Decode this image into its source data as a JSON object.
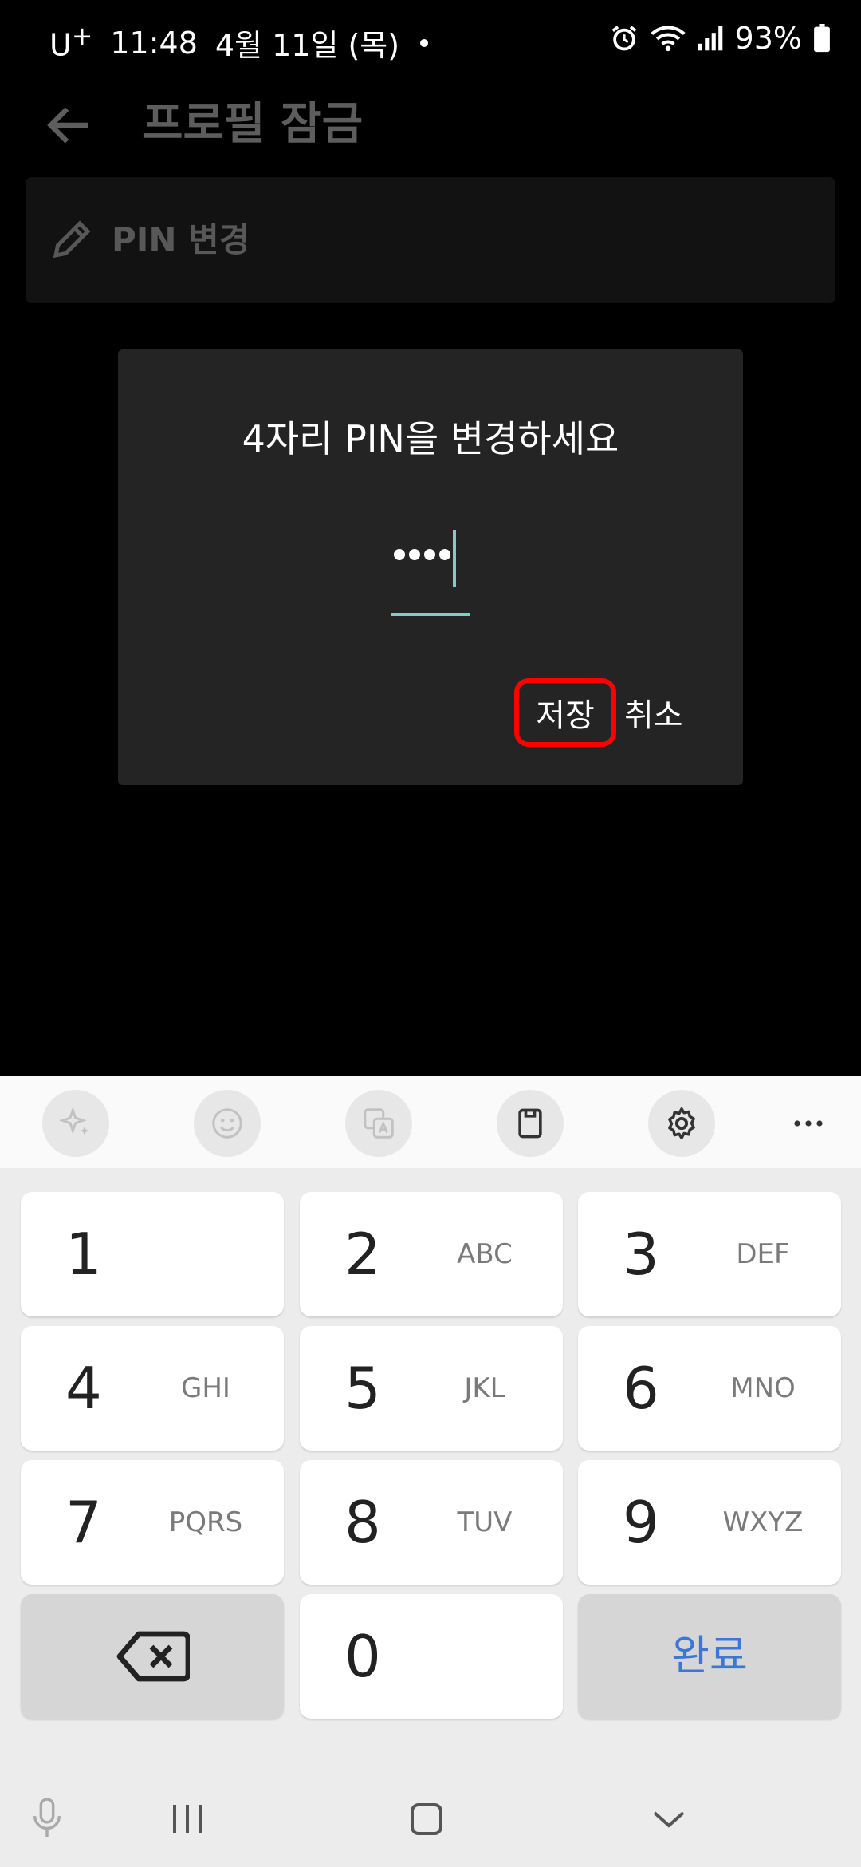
{
  "status_bar": {
    "carrier": "U",
    "carrier_sup": "+",
    "time": "11:48",
    "date": "4월 11일 (목)",
    "battery": "93%"
  },
  "app_bar": {
    "title": "프로필 잠금"
  },
  "settings": {
    "change_pin_label": "PIN 변경"
  },
  "dialog": {
    "title": "4자리 PIN을 변경하세요",
    "pin_length": 4,
    "save_label": "저장",
    "cancel_label": "취소"
  },
  "keyboard": {
    "toolbar_icons": [
      "sparkle-icon",
      "emoji-icon",
      "translate-icon",
      "clipboard-icon",
      "gear-icon",
      "more-icon"
    ],
    "rows": [
      [
        {
          "digit": "1",
          "letters": ""
        },
        {
          "digit": "2",
          "letters": "ABC"
        },
        {
          "digit": "3",
          "letters": "DEF"
        }
      ],
      [
        {
          "digit": "4",
          "letters": "GHI"
        },
        {
          "digit": "5",
          "letters": "JKL"
        },
        {
          "digit": "6",
          "letters": "MNO"
        }
      ],
      [
        {
          "digit": "7",
          "letters": "PQRS"
        },
        {
          "digit": "8",
          "letters": "TUV"
        },
        {
          "digit": "9",
          "letters": "WXYZ"
        }
      ]
    ],
    "zero": "0",
    "done_label": "완료",
    "accent_color": "#3c76d8"
  },
  "colors": {
    "cursor_accent": "#7ccfc2",
    "highlight": "#ff0000"
  }
}
